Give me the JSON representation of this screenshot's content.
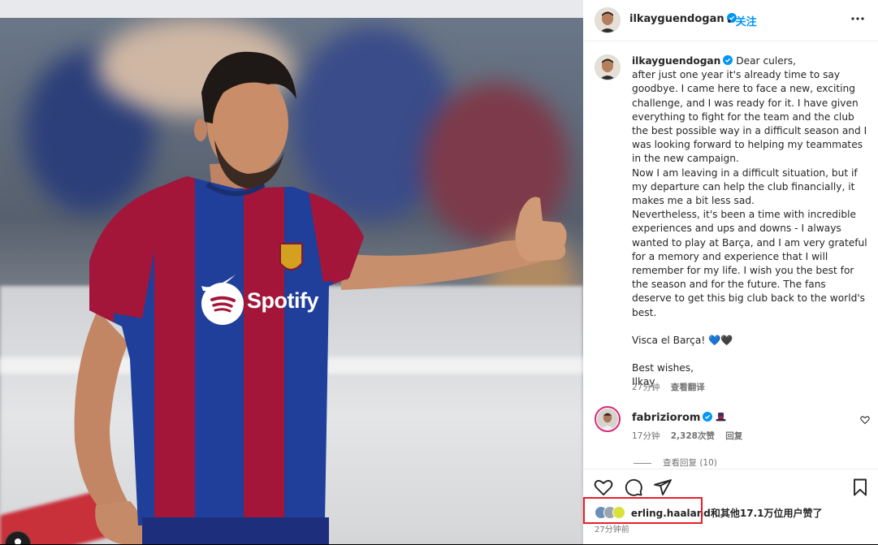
{
  "header": {
    "username": "ilkayguendogan",
    "separator": "•",
    "follow_label": "关注",
    "more_icon": "more-horizontal-icon"
  },
  "caption": {
    "username": "ilkayguendogan",
    "paragraphs": [
      "Dear culers,",
      "after just one year it's already time to say goodbye. I came here to face a new, exciting challenge, and I was ready for it. I have given everything to fight for the team and the club the best possible way in a difficult season and I was looking forward to helping my teammates in the new campaign.",
      "Now I am leaving in a difficult situation, but if my departure can help the club financially, it makes me a bit less sad.",
      "Nevertheless, it's been a time with incredible experiences and ups and downs - I always wanted to play at Barça, and I am very grateful for a memory and experience that I will remember for my life. I wish you the best for the season and for the future. The fans deserve to get this big club back to the world's best.",
      "",
      "Visca el Barça! 💙🖤",
      "",
      "Best wishes,",
      "Ilkay"
    ],
    "time": "27分钟",
    "translate_label": "查看翻译"
  },
  "comment": {
    "username": "fabriziorom",
    "emoji_icon": "top-hat-icon",
    "time": "17分钟",
    "likes": "2,328次赞",
    "reply_label": "回复",
    "view_replies": "查看回复 (10)"
  },
  "likes": {
    "liker": "erling.haaland",
    "rest": "和其他17.1万位用户赞了"
  },
  "post_time": "27分钟前",
  "photo": {
    "jersey_sponsor": "Spotify"
  },
  "colors": {
    "follow_blue": "#0095f6",
    "verified_blue": "#0095f6",
    "highlight_red": "#e8202a",
    "jersey_blue": "#1f3f9a",
    "jersey_red": "#a3163a"
  }
}
